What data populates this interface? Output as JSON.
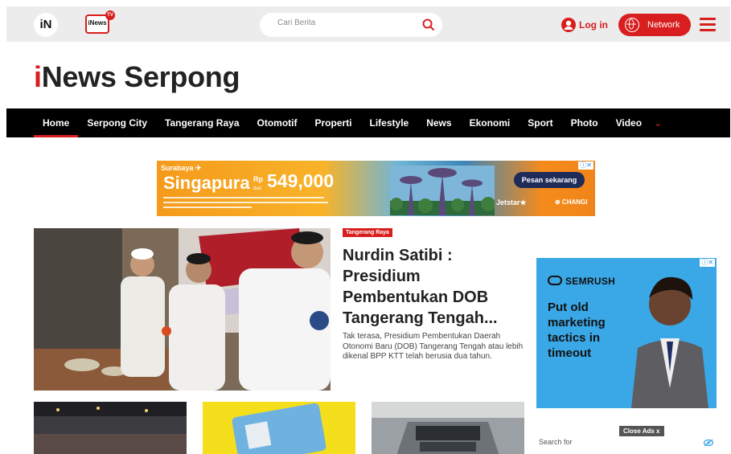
{
  "header": {
    "logo_text": "iN",
    "tv_logo_text": "iNews",
    "tv_badge": "TV",
    "search_placeholder": "Cari Berita",
    "login_label": "Log in",
    "network_label": "Network"
  },
  "brand": {
    "prefix": "i",
    "name": "News Serpong"
  },
  "nav": {
    "items": [
      "Home",
      "Serpong City",
      "Tangerang Raya",
      "Otomotif",
      "Properti",
      "Lifestyle",
      "News",
      "Ekonomi",
      "Sport",
      "Photo",
      "Video"
    ],
    "active_index": 0
  },
  "banner_ad": {
    "airline_line": "Surabaya ✈",
    "destination": "Singapura",
    "price_prefix": "Rp",
    "price_sub": "dari",
    "price": "549,000",
    "cta": "Pesan sekarang",
    "partner1": "Jetstar★",
    "partner2": "⊕ CHANGI"
  },
  "hero": {
    "category": "Tangerang Raya",
    "title": "Nurdin Satibi : Presidium Pembentukan DOB Tangerang Tengah...",
    "summary": "Tak terasa, Presidium Pembentukan Daerah Otonomi Baru (DOB) Tangerang Tengah atau lebih dikenal BPP KTT telah berusia dua tahun."
  },
  "side_ad": {
    "brand": "SEMRUSH",
    "copy": "Put old marketing tactics in timeout",
    "close_label": "Close Ads x",
    "search_label": "Search for"
  },
  "colors": {
    "accent": "#d81e1e",
    "nav_bg": "#000000",
    "topbar_bg": "#ececec"
  }
}
